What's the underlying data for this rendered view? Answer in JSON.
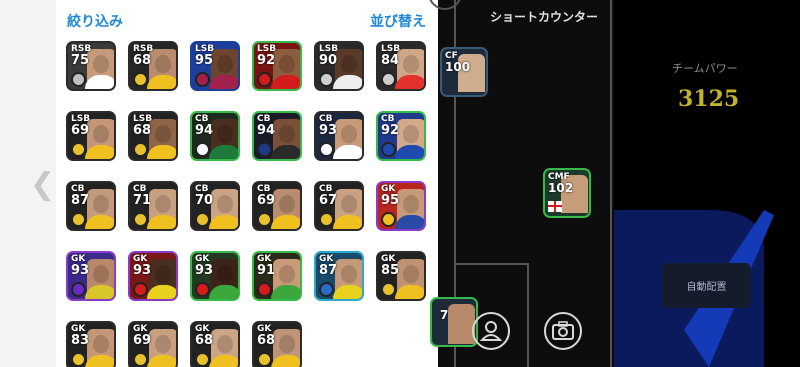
{
  "header": {
    "filter_label": "絞り込み",
    "sort_label": "並び替え"
  },
  "pitch": {
    "formation_label": "ショートカウンター"
  },
  "pitch_players": [
    {
      "pos": "CF",
      "rating": "100"
    },
    {
      "pos": "CMF",
      "rating": "102"
    },
    {
      "pos": "",
      "rating": "7"
    }
  ],
  "team_power": {
    "label": "チームパワー",
    "value": "3125"
  },
  "auto_place": {
    "label": "自動配置"
  },
  "icons": {
    "back": "chevron-left-icon",
    "profile": "user-icon",
    "camera": "camera-icon"
  },
  "players": [
    {
      "pos": "RSB",
      "rating": "75",
      "bg": "#3a3a3a",
      "frame": "#2b2b2b",
      "photo": "#c69b7a",
      "shirt": "#ffffff",
      "badge": "#bfbfbf"
    },
    {
      "pos": "RSB",
      "rating": "68",
      "bg": "#262626",
      "frame": "#2b2b2b",
      "photo": "#b98c6f",
      "shirt": "#f0c020",
      "badge": "#e8c22c"
    },
    {
      "pos": "LSB",
      "rating": "95",
      "bg": "#1d3f9c",
      "frame": "#1d3f9c",
      "photo": "#6b4530",
      "shirt": "#a2214a",
      "badge": "#a2214a"
    },
    {
      "pos": "LSB",
      "rating": "92",
      "bg": "#7a1414",
      "frame": "#36b84a",
      "photo": "#8c5c3e",
      "shirt": "#d41c1c",
      "badge": "#d41c1c"
    },
    {
      "pos": "LSB",
      "rating": "90",
      "bg": "#2a2a2a",
      "frame": "#2b2b2b",
      "photo": "#5a3a28",
      "shirt": "#eeeeee",
      "badge": "#cfcfcf"
    },
    {
      "pos": "LSB",
      "rating": "84",
      "bg": "#2a2a2a",
      "frame": "#2b2b2b",
      "photo": "#d1a686",
      "shirt": "#e53030",
      "badge": "#cfcfcf"
    },
    {
      "pos": "LSB",
      "rating": "69",
      "bg": "#222222",
      "frame": "#2b2b2b",
      "photo": "#c39778",
      "shirt": "#f0c020",
      "badge": "#e8c22c"
    },
    {
      "pos": "LSB",
      "rating": "68",
      "bg": "#222222",
      "frame": "#2b2b2b",
      "photo": "#8f6448",
      "shirt": "#f0c020",
      "badge": "#e8c22c"
    },
    {
      "pos": "CB",
      "rating": "94",
      "bg": "#1d2a1d",
      "frame": "#36b84a",
      "photo": "#4a2e20",
      "shirt": "#1e7a3a",
      "badge": "#ffffff"
    },
    {
      "pos": "CB",
      "rating": "94",
      "bg": "#1a1a2a",
      "frame": "#36b84a",
      "photo": "#7a5038",
      "shirt": "#2a2a2a",
      "badge": "#1f3a8a"
    },
    {
      "pos": "CB",
      "rating": "93",
      "bg": "#1c2740",
      "frame": "#2b2b2b",
      "photo": "#c99a7a",
      "shirt": "#ffffff",
      "badge": "#ffffff"
    },
    {
      "pos": "CB",
      "rating": "92",
      "bg": "#1f3a8a",
      "frame": "#36b84a",
      "photo": "#d4a98a",
      "shirt": "#1f4ab0",
      "badge": "#1f4ab0"
    },
    {
      "pos": "CB",
      "rating": "87",
      "bg": "#222222",
      "frame": "#2b2b2b",
      "photo": "#c49a7c",
      "shirt": "#f0c020",
      "badge": "#e8c22c"
    },
    {
      "pos": "CB",
      "rating": "71",
      "bg": "#222222",
      "frame": "#2b2b2b",
      "photo": "#c8a080",
      "shirt": "#f0c020",
      "badge": "#e8c22c"
    },
    {
      "pos": "CB",
      "rating": "70",
      "bg": "#222222",
      "frame": "#2b2b2b",
      "photo": "#caa284",
      "shirt": "#f0c020",
      "badge": "#e8c22c"
    },
    {
      "pos": "CB",
      "rating": "69",
      "bg": "#222222",
      "frame": "#2b2b2b",
      "photo": "#b88c6c",
      "shirt": "#f0c020",
      "badge": "#e8c22c"
    },
    {
      "pos": "CB",
      "rating": "67",
      "bg": "#222222",
      "frame": "#2b2b2b",
      "photo": "#c9a082",
      "shirt": "#f0c020",
      "badge": "#e8c22c"
    },
    {
      "pos": "GK",
      "rating": "95",
      "bg": "#b8261e",
      "frame": "#8a3cc8",
      "photo": "#c69a78",
      "shirt": "#2a4aa8",
      "badge": "#f0c020"
    },
    {
      "pos": "GK",
      "rating": "93",
      "bg": "#3a2a8a",
      "frame": "#8a3cc8",
      "photo": "#b8886a",
      "shirt": "#d8c62a",
      "badge": "#6a2ac8"
    },
    {
      "pos": "GK",
      "rating": "93",
      "bg": "#7a1818",
      "frame": "#8a3cc8",
      "photo": "#4a2e20",
      "shirt": "#e8d21e",
      "badge": "#d41c1c"
    },
    {
      "pos": "GK",
      "rating": "93",
      "bg": "#223a22",
      "frame": "#36b84a",
      "photo": "#3e2418",
      "shirt": "#3ca83c",
      "badge": "#d41c1c"
    },
    {
      "pos": "GK",
      "rating": "91",
      "bg": "#2a2a1a",
      "frame": "#36b84a",
      "photo": "#c89a78",
      "shirt": "#3ca83c",
      "badge": "#d41c1c"
    },
    {
      "pos": "GK",
      "rating": "87",
      "bg": "#1a4a6a",
      "frame": "#2ea8c8",
      "photo": "#c69a78",
      "shirt": "#e8d21e",
      "badge": "#2a6ac8"
    },
    {
      "pos": "GK",
      "rating": "85",
      "bg": "#222222",
      "frame": "#2b2b2b",
      "photo": "#c09274",
      "shirt": "#f0c020",
      "badge": "#e8c22c"
    },
    {
      "pos": "GK",
      "rating": "83",
      "bg": "#222222",
      "frame": "#2b2b2b",
      "photo": "#c39676",
      "shirt": "#f0c020",
      "badge": "#e8c22c"
    },
    {
      "pos": "GK",
      "rating": "69",
      "bg": "#222222",
      "frame": "#2b2b2b",
      "photo": "#c8a080",
      "shirt": "#f0c020",
      "badge": "#e8c22c"
    },
    {
      "pos": "GK",
      "rating": "68",
      "bg": "#222222",
      "frame": "#2b2b2b",
      "photo": "#ccA486",
      "shirt": "#f0c020",
      "badge": "#e8c22c"
    },
    {
      "pos": "GK",
      "rating": "68",
      "bg": "#222222",
      "frame": "#2b2b2b",
      "photo": "#c09478",
      "shirt": "#f0c020",
      "badge": "#e8c22c"
    }
  ]
}
